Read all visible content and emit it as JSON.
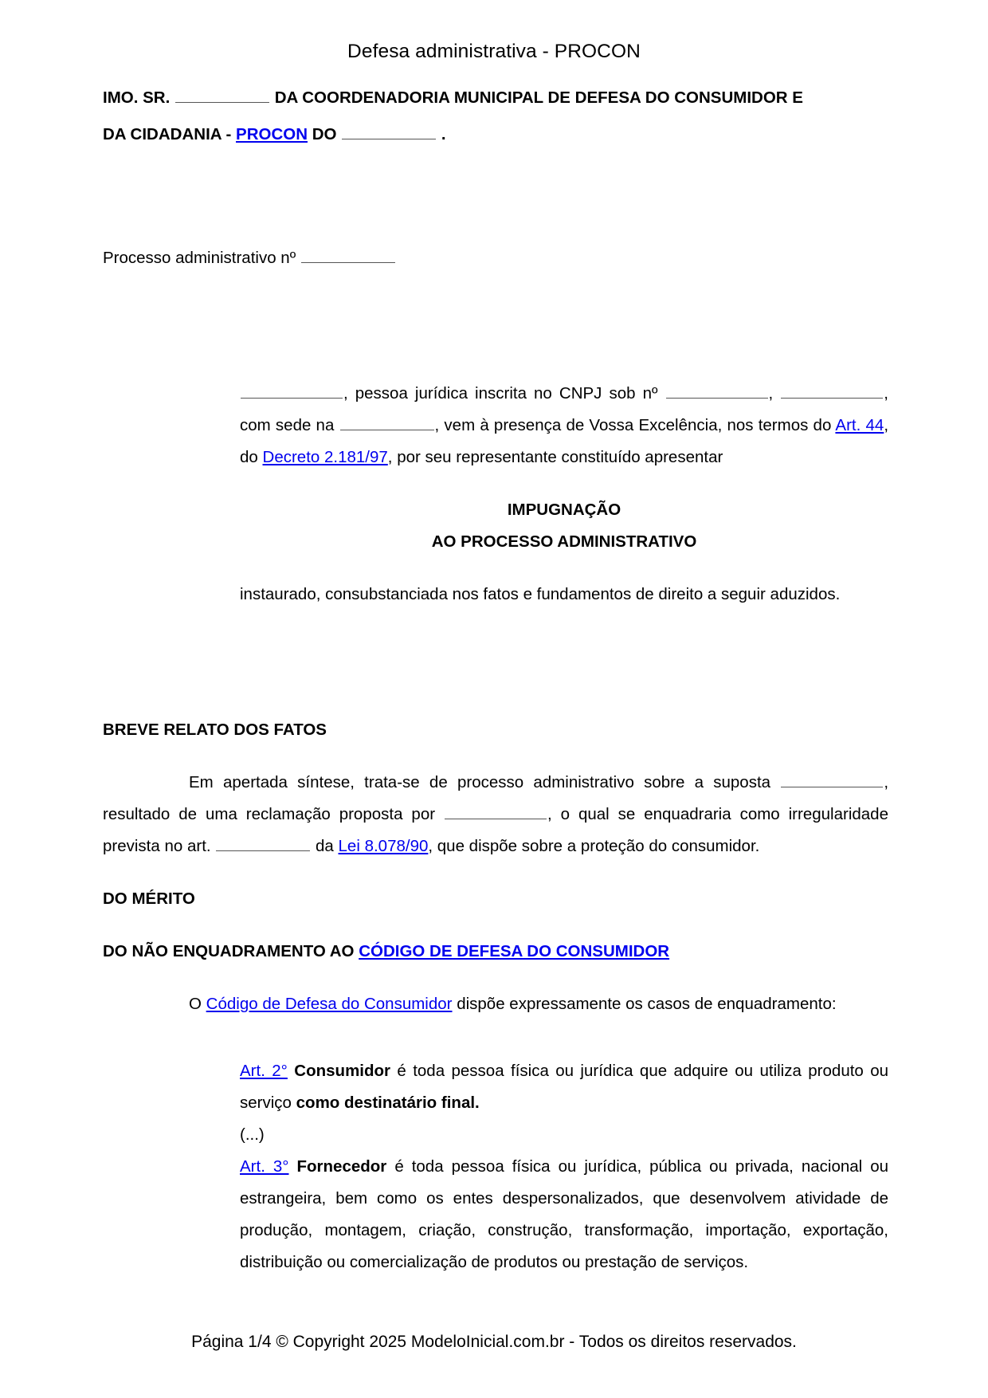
{
  "document": {
    "title": "Defesa administrativa - PROCON",
    "header": {
      "line1_a": "IMO. SR.",
      "line1_b": "DA COORDENADORIA MUNICIPAL DE DEFESA DO CONSUMIDOR E",
      "line2_a": "DA CIDADANIA -",
      "line2_link": "PROCON",
      "line2_b": "DO",
      "line2_c": "."
    },
    "process": {
      "label": "Processo administrativo nº"
    },
    "qualification": {
      "t1": ", pessoa jurídica inscrita no CNPJ sob nº",
      "t2": ",",
      "t3": ", com sede na",
      "t4": ", vem à presença de Vossa Excelência, nos termos do",
      "link_art44": "Art. 44",
      "t5": ", do",
      "link_decreto": "Decreto 2.181/97",
      "t6": ", por seu representante constituído apresentar"
    },
    "impugnacao": {
      "line1": "IMPUGNAÇÃO",
      "line2": "AO PROCESSO ADMINISTRATIVO"
    },
    "instaurado": "instaurado, consubstanciada nos fatos e fundamentos de direito a seguir aduzidos.",
    "sections": {
      "breve_relato": "BREVE RELATO DOS FATOS",
      "do_merito": "DO MÉRITO",
      "nao_enquadramento_a": "DO NÃO ENQUADRAMENTO AO",
      "nao_enquadramento_link": "CÓDIGO DE DEFESA DO CONSUMIDOR"
    },
    "relato": {
      "t1": "Em apertada síntese, trata-se de processo administrativo sobre a suposta",
      "t2": ", resultado de uma reclamação proposta por",
      "t3": ", o qual se enquadraria como irregularidade prevista no art.",
      "t4": "da",
      "link_lei": "Lei 8.078/90",
      "t5": ", que dispõe sobre a proteção do consumidor."
    },
    "cdc_intro": {
      "t1": "O",
      "link": "Código de Defesa do Consumidor",
      "t2": "dispõe expressamente os casos de enquadramento:"
    },
    "quotes": {
      "art2_link": "Art. 2°",
      "art2_bold1": "Consumidor",
      "art2_text1": "é toda pessoa física ou jurídica que adquire ou utiliza produto ou serviço",
      "art2_bold2": "como destinatário final.",
      "ellipsis": "(...)",
      "art3_link": "Art. 3°",
      "art3_bold": "Fornecedor",
      "art3_text": "é toda pessoa física ou jurídica, pública ou privada, nacional ou estrangeira, bem como os entes despersonalizados, que desenvolvem atividade de produção, montagem, criação, construção, transformação, importação, exportação, distribuição ou comercialização de produtos ou prestação de serviços."
    },
    "footer": "Página 1/4 © Copyright 2025 ModeloInicial.com.br - Todos os direitos reservados.",
    "colors": {
      "link": "#0000ee",
      "text": "#000000",
      "blank_rule": "#555555"
    }
  }
}
